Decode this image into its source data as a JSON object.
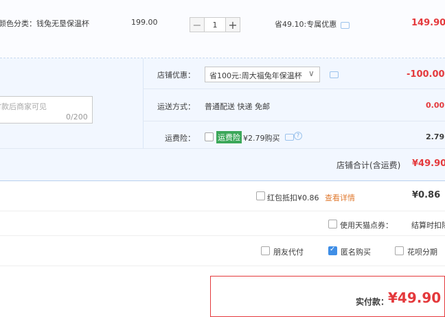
{
  "item": {
    "spec": "颜色分类：钱兔无垦保温杯",
    "unit_price": "199.00",
    "qty_minus": "−",
    "quantity": "1",
    "qty_plus": "+",
    "promo": "省49.10:专属优惠",
    "subtotal": "149.90"
  },
  "shop": {
    "discount_label": "店铺优惠：",
    "discount_value": "省100元:周大福兔年保温杯",
    "discount_amount": "-100.00",
    "memo_placeholder": "付款后商家可见",
    "memo_counter": "0/200",
    "shipping_label": "运送方式：",
    "shipping_value": "普通配送 快递 免邮",
    "shipping_amount": "0.00",
    "insurance_label": "运费险：",
    "insurance_badge": "运费险",
    "insurance_price": "¥2.79购买",
    "insurance_amount": "2.79",
    "total_label": "店铺合计(含运费)",
    "total_value": "¥49.90"
  },
  "redpacket": {
    "label": "红包抵扣¥0.86",
    "link": "查看详情",
    "amount": "¥0.86"
  },
  "tmall_points": {
    "label": "使用天猫点券：",
    "note": "结算时扣除"
  },
  "options": {
    "friend_pay": "朋友代付",
    "anonymous": "匿名购买",
    "huabei": "花呗分期"
  },
  "payment": {
    "label": "实付款：",
    "amount": "¥49.90"
  },
  "colors": {
    "accent_red": "#e4393c",
    "link_blue": "#3f8ee6",
    "badge_green": "#3ba759"
  }
}
